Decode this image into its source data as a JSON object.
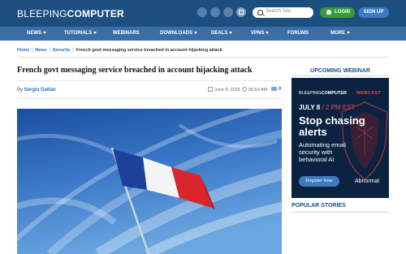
{
  "header": {
    "logo_part1": "BLEEPING",
    "logo_part2": "COMPUTER",
    "search_placeholder": "Search Site",
    "login_label": "LOGIN",
    "signup_label": "SIGN UP"
  },
  "nav": {
    "items": [
      {
        "label": "NEWS"
      },
      {
        "label": "TUTORIALS"
      },
      {
        "label": "WEBINARS"
      },
      {
        "label": "DOWNLOADS"
      },
      {
        "label": "DEALS"
      },
      {
        "label": "VPNS"
      },
      {
        "label": "FORUMS"
      },
      {
        "label": "MORE"
      }
    ]
  },
  "breadcrumb": {
    "home": "Home",
    "news": "News",
    "security": "Security",
    "current": "French govt messaging service breached in account hijacking attack"
  },
  "article": {
    "title": "French govt messaging service breached in account hijacking attack",
    "by": "By",
    "author": "Sergiu Gatlan",
    "date": "June 9, 2026",
    "time": "06:53 AM",
    "comments": "0"
  },
  "sidebar": {
    "webinar_heading": "UPCOMING WEBINAR",
    "popular_heading": "POPULAR STORIES",
    "ad": {
      "logo_part1": "BLEEPING",
      "logo_part2": "COMPUTER",
      "tag": "WEBCAST",
      "date": "JULY 8",
      "time": "/ 2 PM EST",
      "headline": "Stop chasing alerts",
      "sub": "Automating email security with behavioral AI",
      "button": "Register Now",
      "brand": "Abnormal"
    }
  },
  "colors": {
    "header_bg": "#1d4e80",
    "nav_bg": "#3a6ea5",
    "login_green": "#3a9a3a",
    "link_blue": "#2b6cb0",
    "ad_bg": "#0b2340",
    "ad_accent": "#e04a4a"
  }
}
